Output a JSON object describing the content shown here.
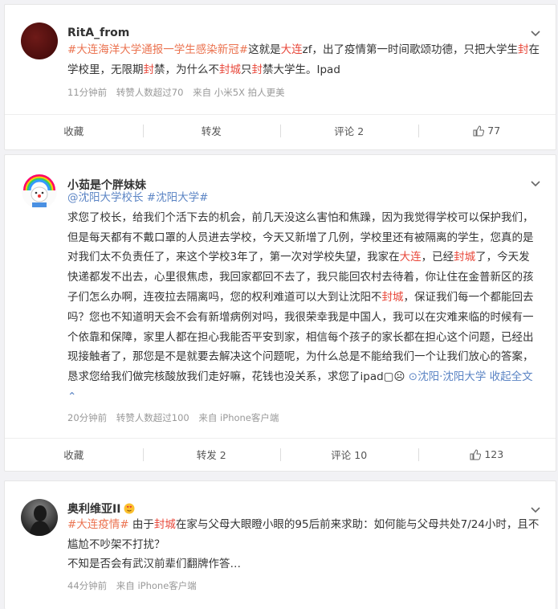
{
  "posts": [
    {
      "username": "RitA_from",
      "content": [
        {
          "t": "#大连海洋大学通报一学生感染新冠#",
          "c": "tag"
        },
        {
          "t": "这就是",
          "c": ""
        },
        {
          "t": "大连",
          "c": "hi"
        },
        {
          "t": "zf，出了疫情第一时间歌颂功德，只把大学生",
          "c": ""
        },
        {
          "t": "封",
          "c": "hi"
        },
        {
          "t": "在学校里，无限期",
          "c": ""
        },
        {
          "t": "封",
          "c": "hi"
        },
        {
          "t": "禁，为什么不",
          "c": ""
        },
        {
          "t": "封城",
          "c": "hi"
        },
        {
          "t": "只",
          "c": ""
        },
        {
          "t": "封",
          "c": "hi"
        },
        {
          "t": "禁大学生。Ipad",
          "c": ""
        }
      ],
      "time": "11分钟前",
      "reposts": "转赞人数超过70",
      "source": "来自 小米5X 拍人更美",
      "actions": {
        "collect": "收藏",
        "repost": "转发",
        "comment": "评论 2",
        "like": "77"
      }
    },
    {
      "username": "小茹是个胖妹妹",
      "content": [
        {
          "t": "@沈阳大学校长",
          "c": "link"
        },
        {
          "t": " ",
          "c": ""
        },
        {
          "t": "#沈阳大学#",
          "c": "link"
        },
        {
          "t": "\n求您了校长，给我们个活下去的机会，前几天没这么害怕和焦躁，因为我觉得学校可以保护我们，但是每天都有不戴口罩的人员进去学校，今天又新增了几例，学校里还有被隔离的学生，您真的是对我们太不负责任了，来这个学校3年了，第一次对学校失望，我家在",
          "c": ""
        },
        {
          "t": "大连",
          "c": "hi"
        },
        {
          "t": "，已经",
          "c": ""
        },
        {
          "t": "封城",
          "c": "hi"
        },
        {
          "t": "了，今天发快递都发不出去，心里很焦虑，我回家都回不去了，我只能回农村去待着，你让住在金普新区的孩子们怎么办啊，连夜拉去隔离吗，您的权利难道可以大到让沈阳不",
          "c": ""
        },
        {
          "t": "封城",
          "c": "hi"
        },
        {
          "t": "，保证我们每一个都能回去吗？您也不知道明天会不会有新增病例对吗，我很荣幸我是中国人，我可以在灾难来临的时候有一个依靠和保障，家里人都在担心我能否平安到家，相信每个孩子的家长都在担心这个问题，已经出现接触者了，那您是不是就要去解决这个问题呢，为什么总是不能给我们一个让我们放心的答案，恳求您给我们做完核酸放我们走好嘛，花钱也没关系，求您了ipad▢☹ ",
          "c": ""
        },
        {
          "t": "⊙沈阳·沈阳大学",
          "c": "link"
        },
        {
          "t": " 收起全文⌃",
          "c": "link"
        }
      ],
      "time": "20分钟前",
      "reposts": "转赞人数超过100",
      "source": "来自 iPhone客户端",
      "actions": {
        "collect": "收藏",
        "repost": "转发 2",
        "comment": "评论 10",
        "like": "123"
      }
    },
    {
      "username": "奥利维亚II",
      "content": [
        {
          "t": "#大连疫情#",
          "c": "tag"
        },
        {
          "t": " 由于",
          "c": ""
        },
        {
          "t": "封城",
          "c": "hi"
        },
        {
          "t": "在家与父母大眼瞪小眼的95后前来求助：如何能与父母共处7/24小时，且不尴尬不吵架不打扰？\n不知是否会有武汉前辈们翻牌作答…",
          "c": ""
        }
      ],
      "time": "44分钟前",
      "source": "来自 iPhone客户端"
    }
  ],
  "icons": {
    "more": "chevron-down-icon",
    "like": "thumbs-up-icon",
    "location": "location-icon"
  },
  "colors": {
    "topic": "#eb7350",
    "keyword": "#e8473a",
    "link": "#5b84c4"
  }
}
